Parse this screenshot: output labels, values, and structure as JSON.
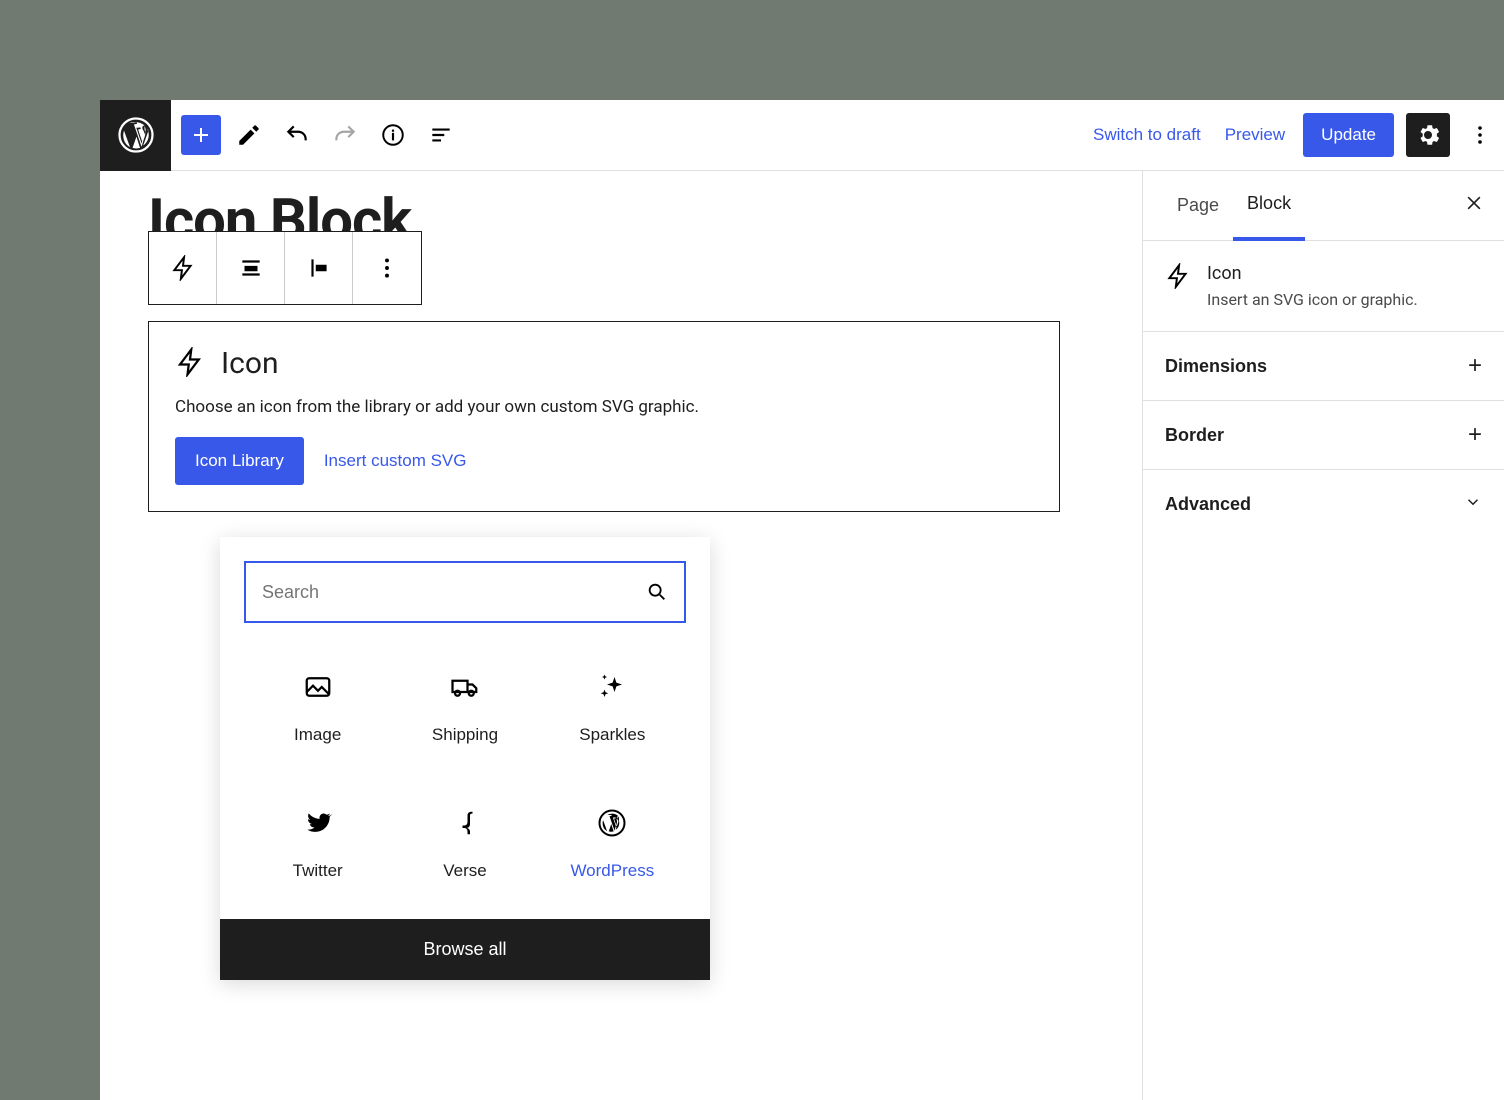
{
  "header": {
    "switch_to_draft": "Switch to draft",
    "preview": "Preview",
    "update": "Update"
  },
  "editor": {
    "page_title": "Icon Block",
    "block": {
      "name": "Icon",
      "description": "Choose an icon from the library or add your own custom SVG graphic.",
      "btn_library": "Icon Library",
      "btn_custom": "Insert custom SVG"
    }
  },
  "popover": {
    "search_placeholder": "Search",
    "browse_all": "Browse all",
    "items": [
      {
        "label": "Image"
      },
      {
        "label": "Shipping"
      },
      {
        "label": "Sparkles"
      },
      {
        "label": "Twitter"
      },
      {
        "label": "Verse"
      },
      {
        "label": "WordPress"
      }
    ]
  },
  "sidebar": {
    "tabs": {
      "page": "Page",
      "block": "Block"
    },
    "block_info": {
      "title": "Icon",
      "desc": "Insert an SVG icon or graphic."
    },
    "panels": {
      "dimensions": "Dimensions",
      "border": "Border",
      "advanced": "Advanced"
    }
  },
  "colors": {
    "accent": "#3858e9",
    "dark": "#1e1e1e"
  }
}
